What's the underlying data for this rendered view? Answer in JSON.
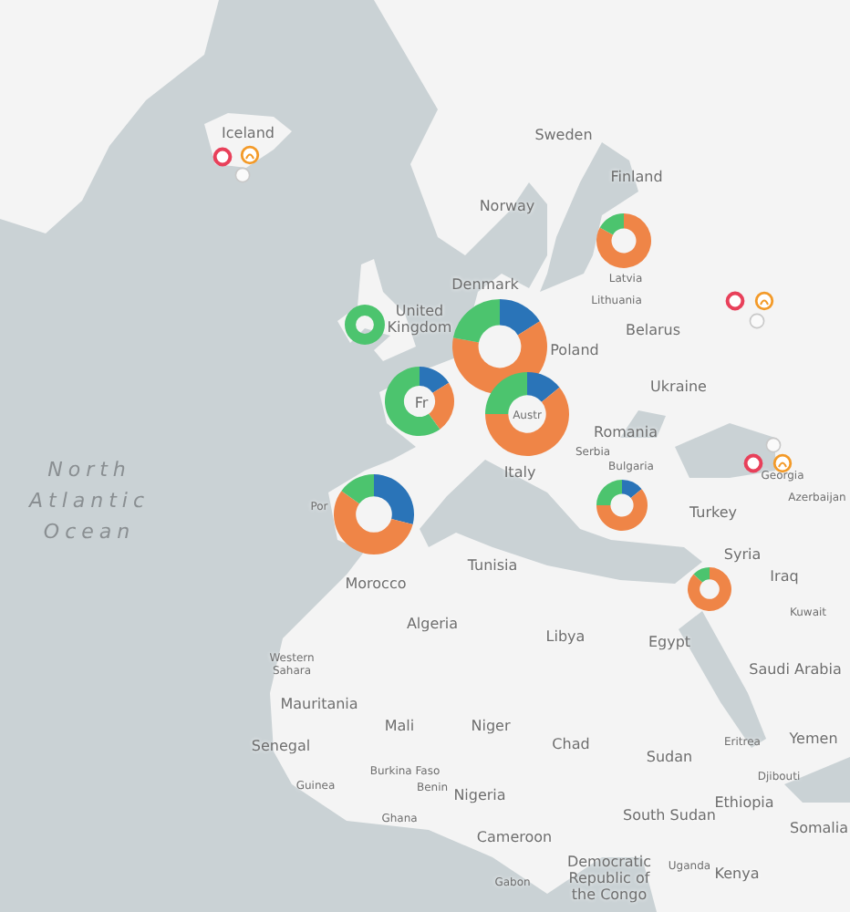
{
  "map": {
    "ocean_label": "North Atlantic Ocean",
    "labels": [
      {
        "text": "Iceland",
        "kind": "country"
      },
      {
        "text": "Sweden",
        "kind": "country"
      },
      {
        "text": "Finland",
        "kind": "country"
      },
      {
        "text": "Norway",
        "kind": "country"
      },
      {
        "text": "Latvia",
        "kind": "small"
      },
      {
        "text": "Lithuania",
        "kind": "small"
      },
      {
        "text": "Denmark",
        "kind": "country"
      },
      {
        "text": "Belarus",
        "kind": "country"
      },
      {
        "text": "United Kingdom",
        "kind": "country"
      },
      {
        "text": "Poland",
        "kind": "country"
      },
      {
        "text": "Ukraine",
        "kind": "country"
      },
      {
        "text": "Fr",
        "kind": "country"
      },
      {
        "text": "Austr",
        "kind": "small"
      },
      {
        "text": "Romania",
        "kind": "country"
      },
      {
        "text": "Serbia",
        "kind": "small"
      },
      {
        "text": "Bulgaria",
        "kind": "small"
      },
      {
        "text": "Italy",
        "kind": "country"
      },
      {
        "text": "Georgia",
        "kind": "small"
      },
      {
        "text": "Azerbaijan",
        "kind": "small"
      },
      {
        "text": "Por",
        "kind": "small"
      },
      {
        "text": "Turkey",
        "kind": "country"
      },
      {
        "text": "Syria",
        "kind": "country"
      },
      {
        "text": "Tunisia",
        "kind": "country"
      },
      {
        "text": "Iraq",
        "kind": "country"
      },
      {
        "text": "Morocco",
        "kind": "country"
      },
      {
        "text": "Kuwait",
        "kind": "small"
      },
      {
        "text": "Algeria",
        "kind": "country"
      },
      {
        "text": "Libya",
        "kind": "country"
      },
      {
        "text": "Egypt",
        "kind": "country"
      },
      {
        "text": "Western Sahara",
        "kind": "small"
      },
      {
        "text": "Saudi Arabia",
        "kind": "country"
      },
      {
        "text": "Mauritania",
        "kind": "country"
      },
      {
        "text": "Mali",
        "kind": "country"
      },
      {
        "text": "Niger",
        "kind": "country"
      },
      {
        "text": "Chad",
        "kind": "country"
      },
      {
        "text": "Eritrea",
        "kind": "small"
      },
      {
        "text": "Yemen",
        "kind": "country"
      },
      {
        "text": "Senegal",
        "kind": "country"
      },
      {
        "text": "Sudan",
        "kind": "country"
      },
      {
        "text": "Burkina Faso",
        "kind": "small"
      },
      {
        "text": "Djibouti",
        "kind": "small"
      },
      {
        "text": "Guinea",
        "kind": "small"
      },
      {
        "text": "Benin",
        "kind": "small"
      },
      {
        "text": "Nigeria",
        "kind": "country"
      },
      {
        "text": "Ethiopia",
        "kind": "country"
      },
      {
        "text": "Ghana",
        "kind": "small"
      },
      {
        "text": "South Sudan",
        "kind": "country"
      },
      {
        "text": "Somalia",
        "kind": "country"
      },
      {
        "text": "Cameroon",
        "kind": "country"
      },
      {
        "text": "Democratic Republic of the Congo",
        "kind": "country"
      },
      {
        "text": "Uganda",
        "kind": "small"
      },
      {
        "text": "Kenya",
        "kind": "country"
      },
      {
        "text": "Gabon",
        "kind": "small"
      }
    ]
  }
}
